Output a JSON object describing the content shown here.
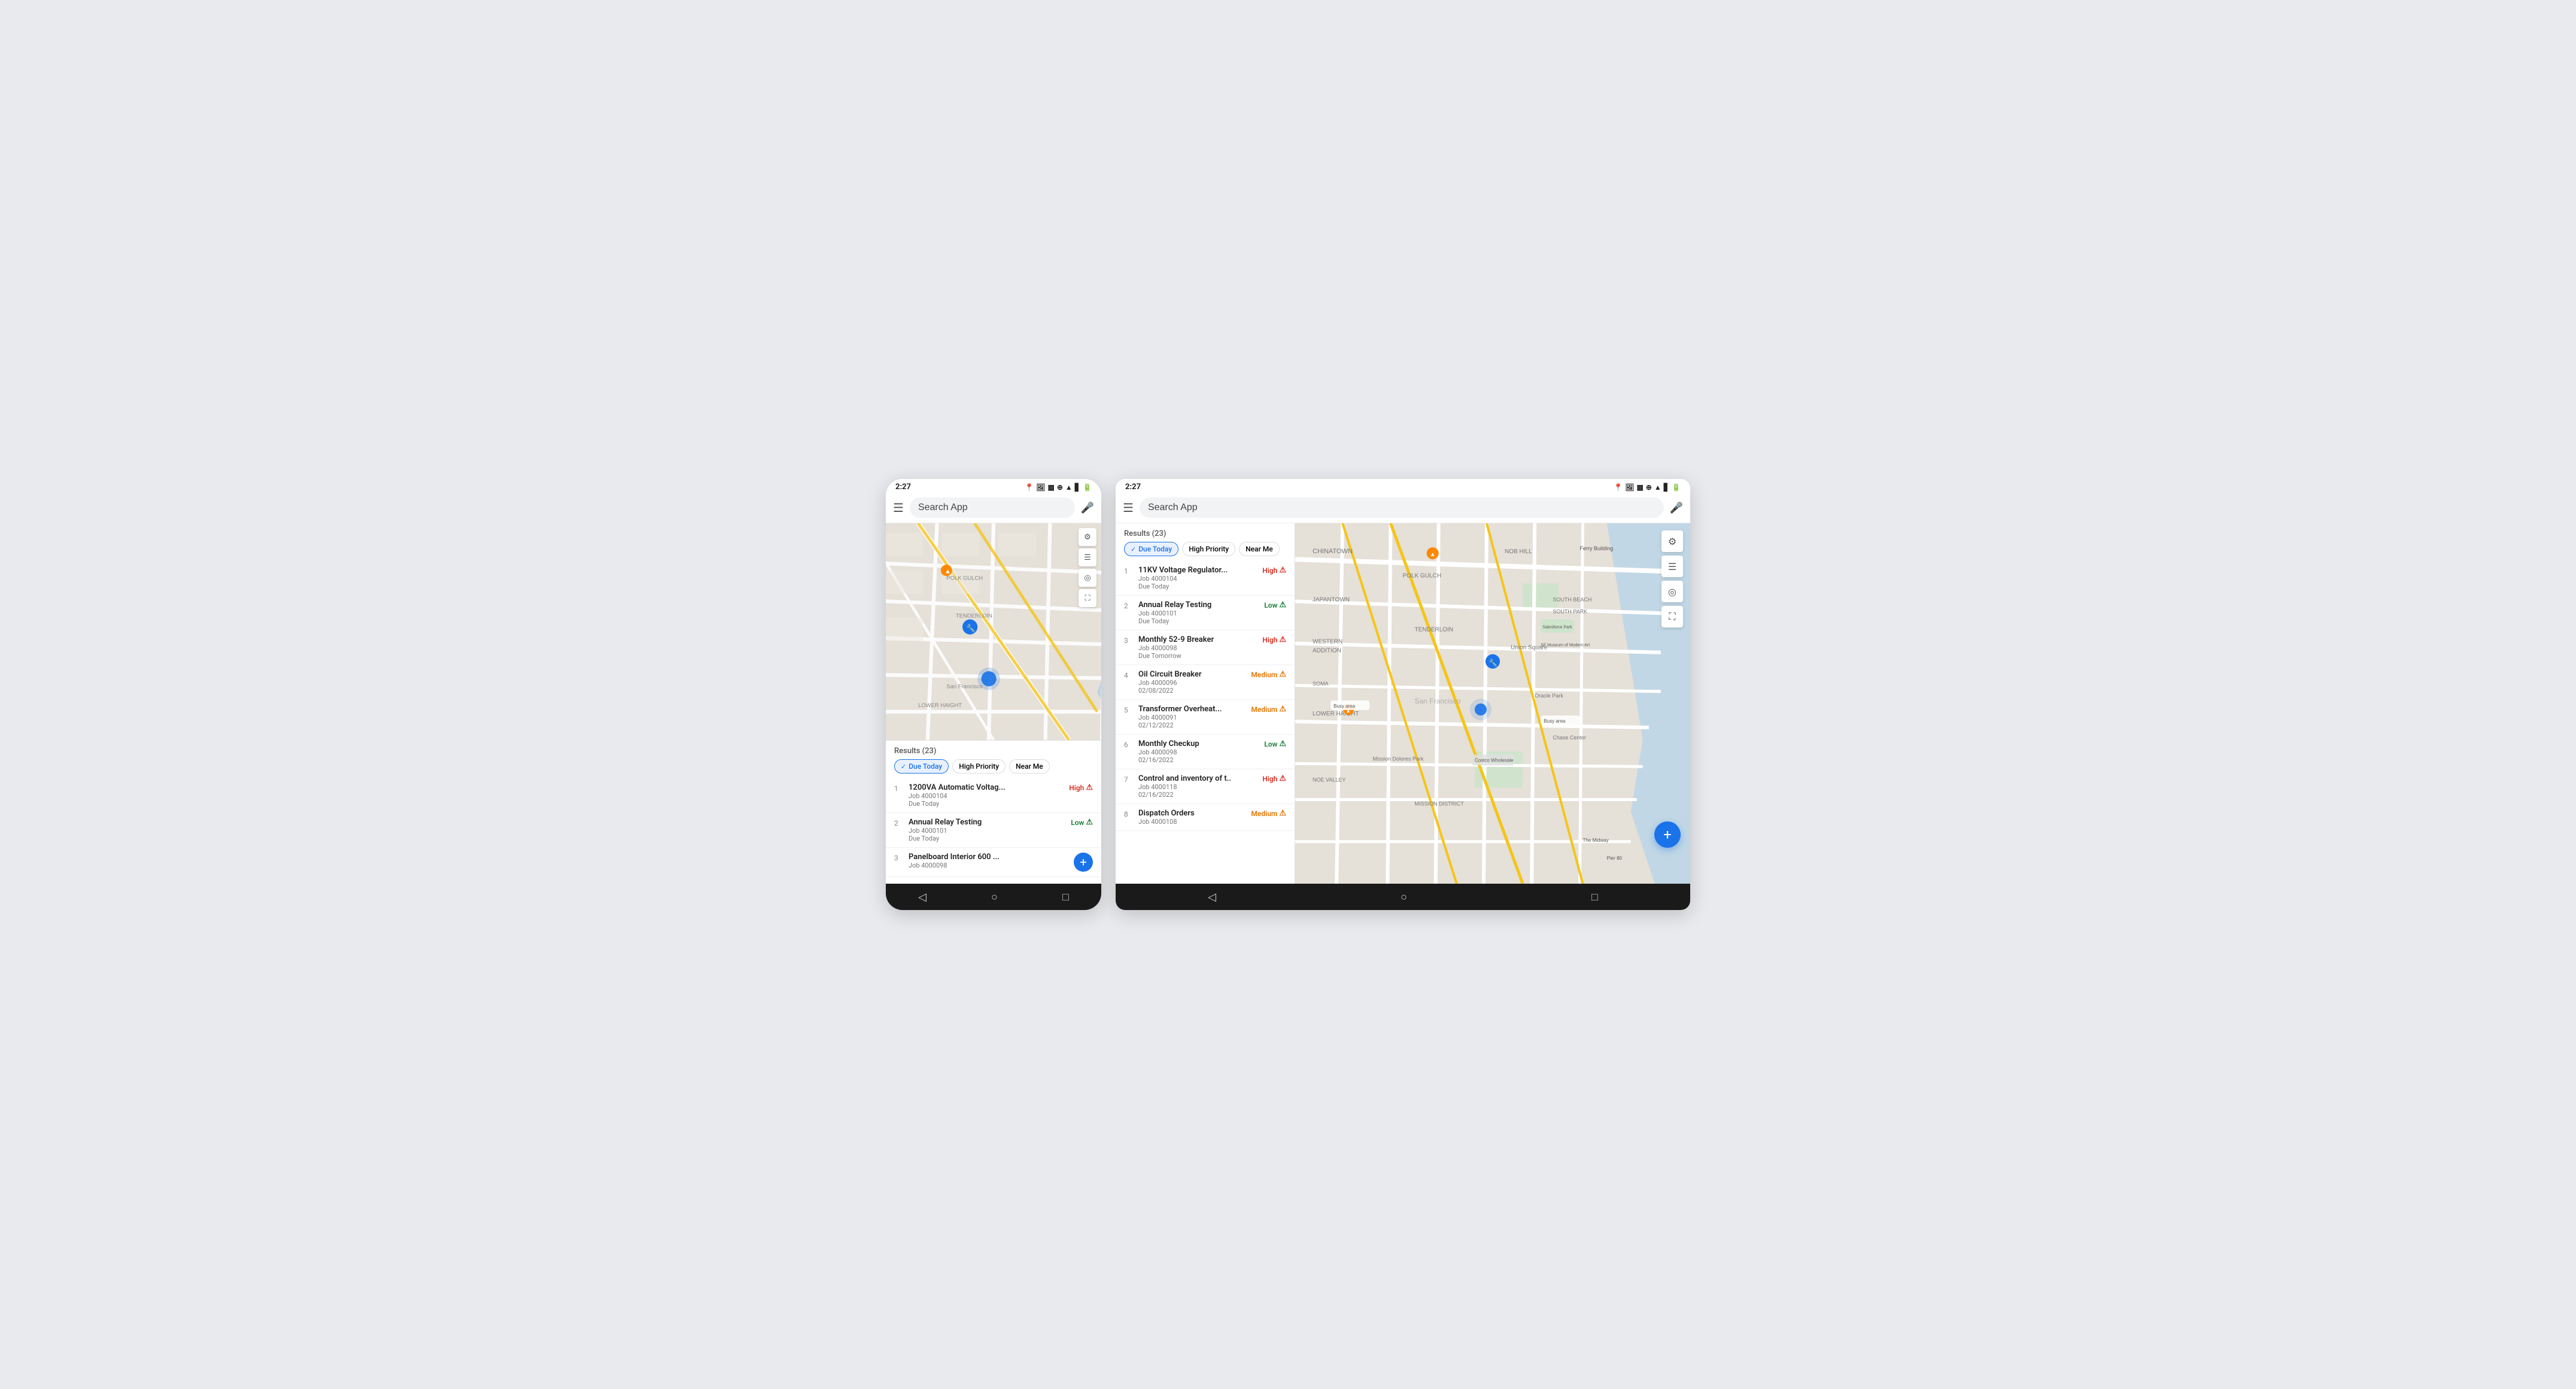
{
  "phone": {
    "status": {
      "time": "2:27",
      "icons": [
        "location",
        "image",
        "grid",
        "navigation",
        "wifi",
        "signal",
        "battery"
      ]
    },
    "search": {
      "placeholder": "Search App",
      "value": "Search App"
    },
    "results_count": "Results (23)",
    "filters": [
      {
        "label": "Due Today",
        "active": true
      },
      {
        "label": "High Priority",
        "active": false
      },
      {
        "label": "Near Me",
        "active": false
      }
    ],
    "jobs": [
      {
        "num": 1,
        "title": "1200VA Automatic Voltag...",
        "job": "Job 4000104",
        "due": "Due Today",
        "priority": "High",
        "priority_level": "high"
      },
      {
        "num": 2,
        "title": "Annual Relay Testing",
        "job": "Job 4000101",
        "due": "Due Today",
        "priority": "Low",
        "priority_level": "low"
      },
      {
        "num": 3,
        "title": "Panelboard Interior 600 ...",
        "job": "Job 4000098",
        "due": "",
        "priority": "",
        "priority_level": ""
      }
    ],
    "fab_label": "+",
    "nav": [
      "◁",
      "○",
      "□"
    ]
  },
  "tablet": {
    "status": {
      "time": "2:27",
      "icons": [
        "location",
        "image",
        "grid",
        "navigation",
        "wifi",
        "signal",
        "battery"
      ]
    },
    "search": {
      "placeholder": "Search App",
      "value": "Search App"
    },
    "results_count": "Results (23)",
    "filters": [
      {
        "label": "Due Today",
        "active": true
      },
      {
        "label": "High Priority",
        "active": false
      },
      {
        "label": "Near Me",
        "active": false
      }
    ],
    "jobs": [
      {
        "num": 1,
        "title": "11KV Voltage Regulator...",
        "job": "Job 4000104",
        "due": "Due Today",
        "priority": "High",
        "priority_level": "high"
      },
      {
        "num": 2,
        "title": "Annual Relay Testing",
        "job": "Job 4000101",
        "due": "Due Today",
        "priority": "Low",
        "priority_level": "low"
      },
      {
        "num": 3,
        "title": "Monthly 52-9 Breaker",
        "job": "Job 4000098",
        "due": "Due Tomorrow",
        "priority": "High",
        "priority_level": "high"
      },
      {
        "num": 4,
        "title": "Oil Circuit Breaker",
        "job": "Job 4000096",
        "due": "02/08/2022",
        "priority": "Medium",
        "priority_level": "medium"
      },
      {
        "num": 5,
        "title": "Transformer Overheat...",
        "job": "Job 4000091",
        "due": "02/12/2022",
        "priority": "Medium",
        "priority_level": "medium"
      },
      {
        "num": 6,
        "title": "Monthly Checkup",
        "job": "Job 4000098",
        "due": "02/16/2022",
        "priority": "Low",
        "priority_level": "low"
      },
      {
        "num": 7,
        "title": "Control and inventory of t..",
        "job": "Job 4000118",
        "due": "02/16/2022",
        "priority": "High",
        "priority_level": "high"
      },
      {
        "num": 8,
        "title": "Dispatch Orders",
        "job": "Job 4000108",
        "due": "",
        "priority": "Medium",
        "priority_level": "medium"
      }
    ],
    "fab_label": "+",
    "nav": [
      "◁",
      "○",
      "□"
    ],
    "map_buttons": [
      "⚙",
      "☰",
      "◎",
      "⛶"
    ]
  }
}
